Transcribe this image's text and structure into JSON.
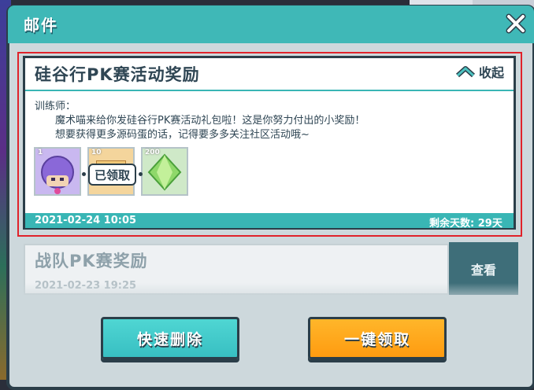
{
  "header": {
    "title": "邮件",
    "close_icon": "close-icon"
  },
  "mails": [
    {
      "title": "硅谷行PK赛活动奖励",
      "collapse_label": "收起",
      "greeting": "训练师：",
      "body": [
        "魔术喵来给你发硅谷行PK赛活动礼包啦！这是你努力付出的小奖励！",
        "想要获得更多源码蛋的话，记得要多多关注社区活动哦~"
      ],
      "items": [
        {
          "icon": "purple-ball-avatar-icon",
          "qty": "1"
        },
        {
          "icon": "crate-icon",
          "qty": "10"
        },
        {
          "icon": "green-crystal-icon",
          "qty": "200"
        }
      ],
      "claimed_label": "已领取",
      "date": "2021-02-24 10:05",
      "days_left": "剩余天数: 29天"
    },
    {
      "title": "战队PK赛奖励",
      "date": "2021-02-23 19:25",
      "view_label": "查看"
    }
  ],
  "buttons": {
    "delete_all": "快速删除",
    "claim_all": "一键领取"
  },
  "colors": {
    "header": "#3fb8b7",
    "border": "#2b3e49",
    "accent": "#39b6b5",
    "claim": "#ff9b10",
    "highlight": "#e0222a"
  }
}
